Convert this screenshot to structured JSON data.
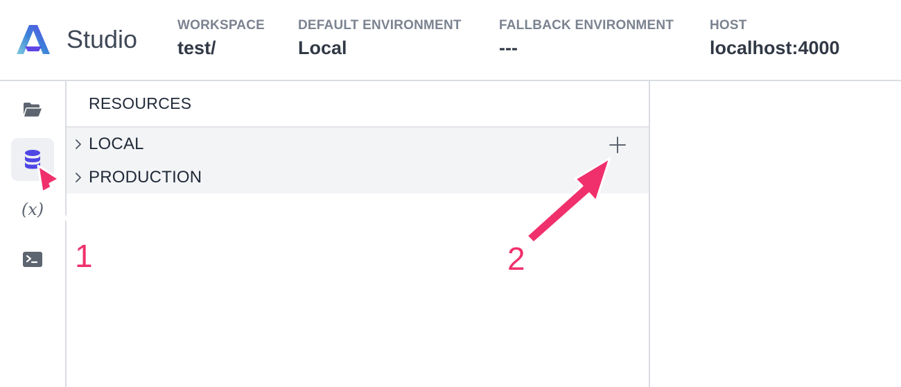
{
  "app": {
    "name": "Studio",
    "logo_icon": "studio-logo-icon",
    "brand_colors": [
      "#5f47e6",
      "#3b82d8",
      "#7fc9dd"
    ]
  },
  "header": {
    "workspace": {
      "label": "WORKSPACE",
      "value": "test/"
    },
    "default_environment": {
      "label": "DEFAULT ENVIRONMENT",
      "value": "Local"
    },
    "fallback_environment": {
      "label": "FALLBACK ENVIRONMENT",
      "value": "---"
    },
    "host": {
      "label": "HOST",
      "value": "localhost:4000"
    }
  },
  "sidebar": {
    "items": [
      {
        "name": "folder",
        "icon": "folder-open-icon",
        "active": false
      },
      {
        "name": "database",
        "icon": "database-icon",
        "active": true
      },
      {
        "name": "variables",
        "icon": "variable-icon",
        "glyph": "(x)",
        "active": false
      },
      {
        "name": "terminal",
        "icon": "terminal-icon",
        "active": false
      }
    ]
  },
  "resources": {
    "title": "RESOURCES",
    "items": [
      {
        "label": "LOCAL",
        "icon": "chevron-right-icon",
        "action_icon": "plus-icon"
      },
      {
        "label": "PRODUCTION",
        "icon": "chevron-right-icon"
      }
    ]
  },
  "annotations": {
    "color": "#f0306c",
    "labels": [
      "1",
      "2"
    ]
  }
}
